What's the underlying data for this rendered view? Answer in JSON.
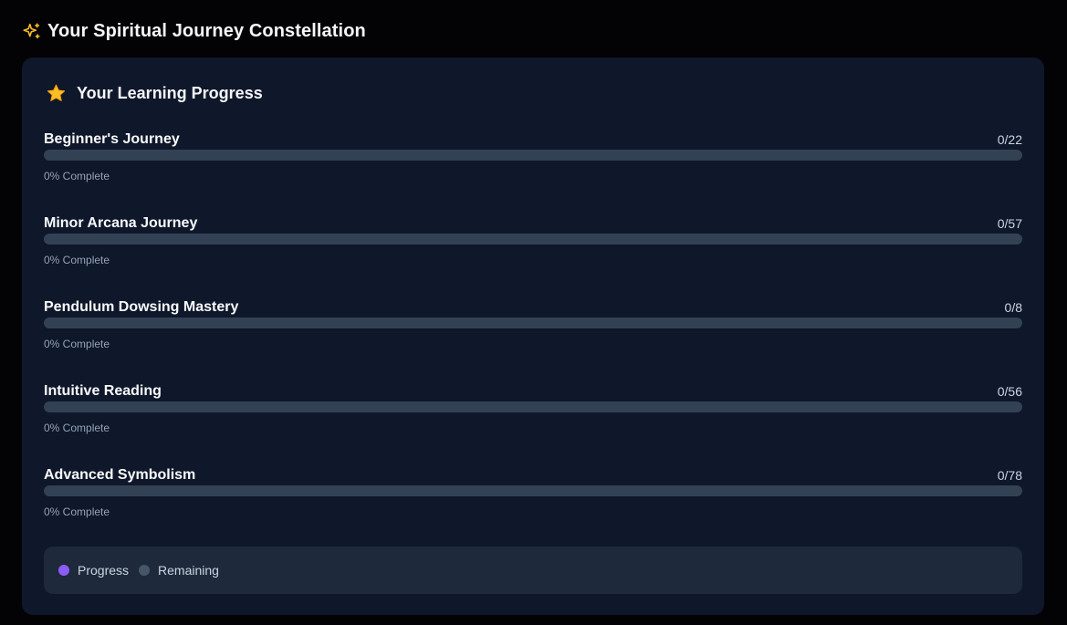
{
  "header": {
    "title": "Your Spiritual Journey Constellation",
    "icon": "sparkle-icon",
    "icon_color": "#fbbf24"
  },
  "panel": {
    "title": "Your Learning Progress",
    "icon": "star-icon",
    "icon_color": "#fbbf24",
    "background": "#0f172a"
  },
  "tracks": [
    {
      "name": "Beginner's Journey",
      "count": "0/22",
      "percent_label": "0% Complete",
      "progress": 0
    },
    {
      "name": "Minor Arcana Journey",
      "count": "0/57",
      "percent_label": "0% Complete",
      "progress": 0
    },
    {
      "name": "Pendulum Dowsing Mastery",
      "count": "0/8",
      "percent_label": "0% Complete",
      "progress": 0
    },
    {
      "name": "Intuitive Reading",
      "count": "0/56",
      "percent_label": "0% Complete",
      "progress": 0
    },
    {
      "name": "Advanced Symbolism",
      "count": "0/78",
      "percent_label": "0% Complete",
      "progress": 0
    }
  ],
  "legend": {
    "progress_label": "Progress",
    "progress_color": "#8b5cf6",
    "remaining_label": "Remaining",
    "remaining_color": "#475569"
  }
}
